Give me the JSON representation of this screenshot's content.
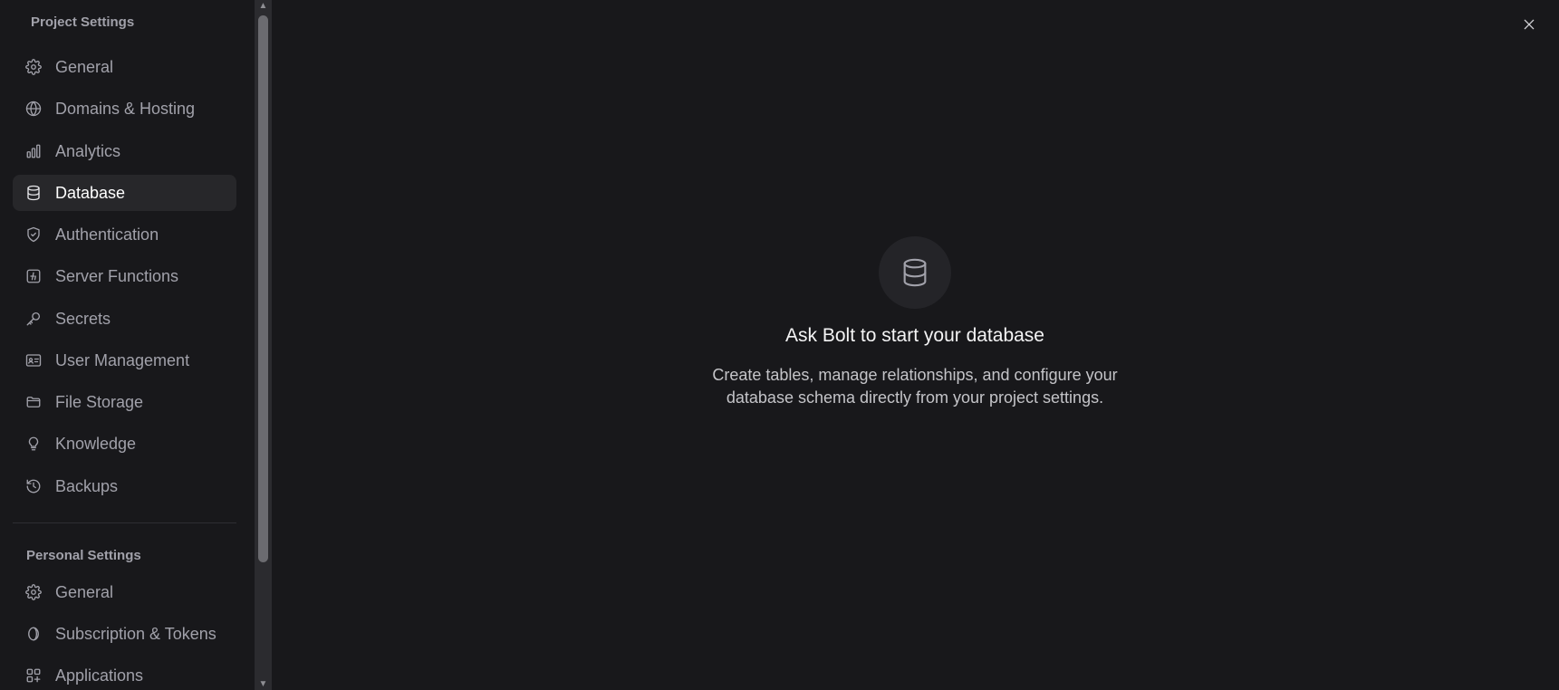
{
  "sidebar": {
    "project_title": "Project Settings",
    "project_items": [
      {
        "label": "General",
        "icon": "gear-icon"
      },
      {
        "label": "Domains & Hosting",
        "icon": "globe-icon"
      },
      {
        "label": "Analytics",
        "icon": "bar-chart-icon"
      },
      {
        "label": "Database",
        "icon": "database-icon",
        "active": true
      },
      {
        "label": "Authentication",
        "icon": "shield-check-icon"
      },
      {
        "label": "Server Functions",
        "icon": "function-icon"
      },
      {
        "label": "Secrets",
        "icon": "key-icon"
      },
      {
        "label": "User Management",
        "icon": "id-card-icon"
      },
      {
        "label": "File Storage",
        "icon": "folder-icon"
      },
      {
        "label": "Knowledge",
        "icon": "lightbulb-icon"
      },
      {
        "label": "Backups",
        "icon": "history-icon"
      }
    ],
    "personal_title": "Personal Settings",
    "personal_items": [
      {
        "label": "General",
        "icon": "gear-icon"
      },
      {
        "label": "Subscription & Tokens",
        "icon": "coin-icon"
      },
      {
        "label": "Applications",
        "icon": "apps-grid-icon"
      }
    ]
  },
  "main": {
    "empty_title": "Ask Bolt to start your database",
    "empty_desc_line1": "Create tables, manage relationships, and configure your",
    "empty_desc_line2": "database schema directly from your project settings."
  },
  "colors": {
    "background": "#18181b",
    "active_item": "#27272a",
    "text_muted": "#a1a1aa",
    "text_bright": "#ffffff"
  }
}
